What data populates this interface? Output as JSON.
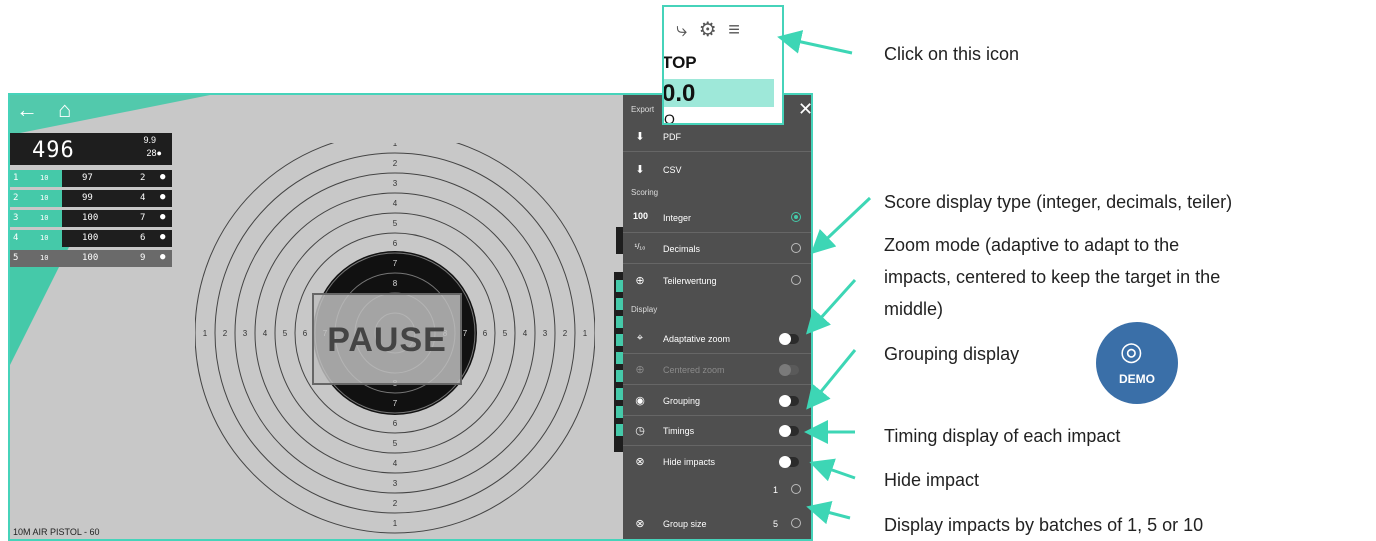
{
  "app": {
    "nav": {
      "back_icon": "arrow-left-icon",
      "home_icon": "home-icon"
    },
    "score": {
      "total": "496",
      "decimal": "9.9",
      "x_count": "28●"
    },
    "series_rows": [
      {
        "index": "1",
        "count": "10",
        "score": "97",
        "xs": "2",
        "dot": "●"
      },
      {
        "index": "2",
        "count": "10",
        "score": "99",
        "xs": "4",
        "dot": "●"
      },
      {
        "index": "3",
        "count": "10",
        "score": "100",
        "xs": "7",
        "dot": "●"
      },
      {
        "index": "4",
        "count": "10",
        "score": "100",
        "xs": "6",
        "dot": "●"
      },
      {
        "index": "5",
        "count": "10",
        "score": "100",
        "xs": "9",
        "dot": "●"
      }
    ],
    "target_numbers": [
      "1",
      "2",
      "3",
      "4",
      "5",
      "6",
      "7",
      "8"
    ],
    "pause_label": "PAUSE",
    "discipline": "10M AIR PISTOL - 60"
  },
  "settings": {
    "close_icon": "close-icon",
    "export_header": "Export",
    "pdf_label": "PDF",
    "csv_label": "CSV",
    "scoring_header": "Scoring",
    "integer_icon": "100",
    "integer_label": "Integer",
    "decimals_icon": "¹/₁₀",
    "decimals_label": "Decimals",
    "teiler_label": "Teilerwertung",
    "display_header": "Display",
    "adaptive_zoom_label": "Adaptative zoom",
    "centered_zoom_label": "Centered zoom",
    "grouping_label": "Grouping",
    "timings_label": "Timings",
    "hide_impacts_label": "Hide impacts",
    "batch_1": "1",
    "group_size_label": "Group size",
    "batch_5": "5"
  },
  "inset": {
    "icons": [
      "wireless-icon",
      "gear-icon",
      "menu-icon"
    ],
    "top_text": "TOP",
    "score_text": "0.0",
    "small_text": "O"
  },
  "annotations": {
    "click_icon": "Click on this icon",
    "score_type": "Score display type (integer, decimals, teiler)",
    "zoom_mode_1": "Zoom mode (adaptive to adapt to the",
    "zoom_mode_2": "impacts, centered to keep the target in the",
    "zoom_mode_3": "middle)",
    "grouping": "Grouping display",
    "timing": "Timing display of each impact",
    "hide": "Hide impact",
    "batches": "Display impacts by batches of 1, 5 or 10",
    "demo_label": "DEMO"
  },
  "colors": {
    "accent": "#45c9a9",
    "panel": "#4f4f4f",
    "target_bg": "#c8c8c8",
    "demo_badge": "#3a6fa8"
  }
}
